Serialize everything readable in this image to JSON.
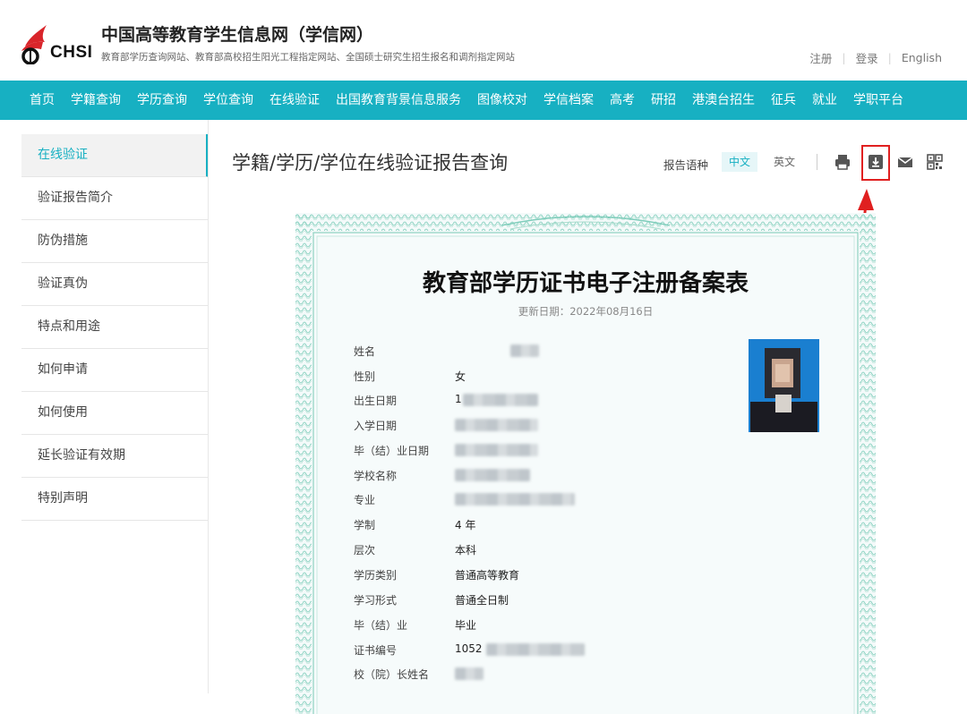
{
  "header": {
    "logo_text": "CHSI",
    "site_title": "中国高等教育学生信息网（学信网）",
    "site_subtitle": "教育部学历查询网站、教育部高校招生阳光工程指定网站、全国硕士研究生招生报名和调剂指定网站",
    "links": [
      "注册",
      "登录",
      "English"
    ]
  },
  "nav": [
    "首页",
    "学籍查询",
    "学历查询",
    "学位查询",
    "在线验证",
    "出国教育背景信息服务",
    "图像校对",
    "学信档案",
    "高考",
    "研招",
    "港澳台招生",
    "征兵",
    "就业",
    "学职平台"
  ],
  "sidebar": [
    "在线验证",
    "验证报告简介",
    "防伪措施",
    "验证真伪",
    "特点和用途",
    "如何申请",
    "如何使用",
    "延长验证有效期",
    "特别声明"
  ],
  "content": {
    "title": "学籍/学历/学位在线验证报告查询",
    "lang_label": "报告语种",
    "lang_cn": "中文",
    "lang_en": "英文"
  },
  "colors": {
    "accent": "#17b0c2",
    "highlight": "#e02020"
  },
  "icons": [
    "print-icon",
    "download-icon",
    "mail-icon",
    "qrcode-icon"
  ],
  "certificate": {
    "title": "教育部学历证书电子注册备案表",
    "update_date": "更新日期：2022年08月16日",
    "fields": {
      "name": "姓名",
      "gender": "性别",
      "gender_value": "女",
      "birth": "出生日期",
      "birth_value": "1",
      "enroll": "入学日期",
      "graduate_date": "毕（结）业日期",
      "school": "学校名称",
      "major": "专业",
      "duration": "学制",
      "duration_value": "4 年",
      "level": "层次",
      "level_value": "本科",
      "edu_type": "学历类别",
      "edu_type_value": "普通高等教育",
      "study_form": "学习形式",
      "study_form_value": "普通全日制",
      "graduation": "毕（结）业",
      "graduation_value": "毕业",
      "cert_no": "证书编号",
      "cert_no_value": "1052",
      "principal": "校（院）长姓名"
    }
  }
}
